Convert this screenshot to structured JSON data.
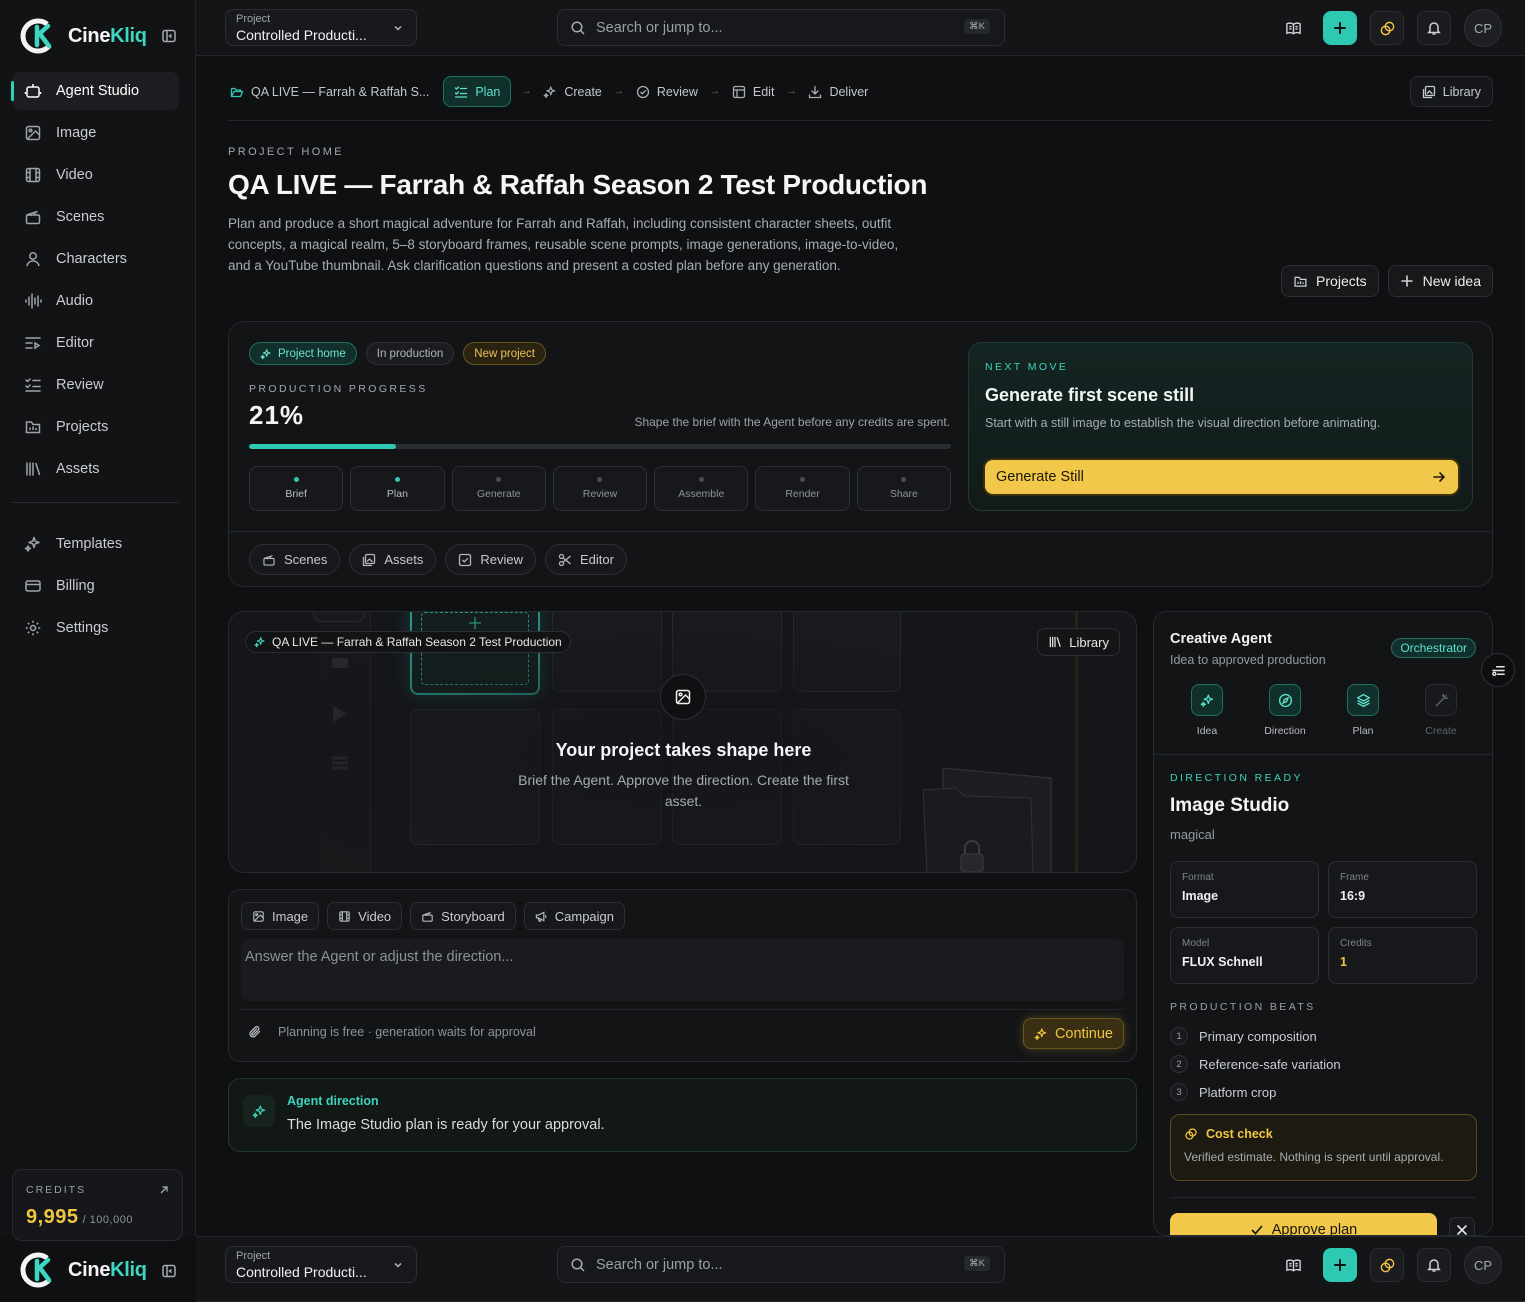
{
  "brand": {
    "name_prefix": "Cine",
    "name_accent": "Kliq",
    "accent_color": "#3ed6c1"
  },
  "sidebar": {
    "items": [
      {
        "label": "Agent Studio",
        "icon": "bot-icon",
        "active": true
      },
      {
        "label": "Image",
        "icon": "image-icon"
      },
      {
        "label": "Video",
        "icon": "film-icon"
      },
      {
        "label": "Scenes",
        "icon": "clapperboard-icon"
      },
      {
        "label": "Characters",
        "icon": "user-icon"
      },
      {
        "label": "Audio",
        "icon": "audio-wave-icon"
      },
      {
        "label": "Editor",
        "icon": "editor-icon"
      },
      {
        "label": "Review",
        "icon": "checklist-icon"
      },
      {
        "label": "Projects",
        "icon": "folder-icon"
      },
      {
        "label": "Assets",
        "icon": "library-icon"
      }
    ],
    "secondary": [
      {
        "label": "Templates",
        "icon": "sparkles-icon"
      },
      {
        "label": "Billing",
        "icon": "credit-card-icon"
      },
      {
        "label": "Settings",
        "icon": "gear-icon"
      }
    ],
    "credits": {
      "label": "CREDITS",
      "value": "9,995",
      "total": "/ 100,000"
    }
  },
  "topbar": {
    "project_label": "Project",
    "project_value": "Controlled Producti...",
    "search_placeholder": "Search or jump to...",
    "search_shortcut": "⌘K",
    "avatar_initials": "CP"
  },
  "breadcrumbs": {
    "home": "QA LIVE — Farrah & Raffah S...",
    "steps": [
      {
        "label": "Plan",
        "icon": "checklist-icon",
        "active": true
      },
      {
        "label": "Create",
        "icon": "sparkles-icon"
      },
      {
        "label": "Review",
        "icon": "check-circle-icon"
      },
      {
        "label": "Edit",
        "icon": "layout-icon"
      },
      {
        "label": "Deliver",
        "icon": "download-icon"
      }
    ],
    "library": "Library"
  },
  "header": {
    "eyebrow": "PROJECT HOME",
    "title": "QA LIVE — Farrah & Raffah Season 2 Test Production",
    "description": "Plan and produce a short magical adventure for Farrah and Raffah, including consistent character sheets, outfit concepts, a magical realm, 5–8 storyboard frames, reusable scene prompts, image generations, image-to-video, and a YouTube thumbnail. Ask clarification questions and present a costed plan before any generation.",
    "projects_button": "Projects",
    "new_idea_button": "New idea"
  },
  "production": {
    "pills": [
      "Project home",
      "In production",
      "New project"
    ],
    "eyebrow": "PRODUCTION PROGRESS",
    "progress_label": "21%",
    "progress": 0.21,
    "hint": "Shape the brief with the Agent before any credits are spent.",
    "steps": [
      {
        "label": "Brief",
        "done": true
      },
      {
        "label": "Plan",
        "done": true
      },
      {
        "label": "Generate",
        "done": false
      },
      {
        "label": "Review",
        "done": false
      },
      {
        "label": "Assemble",
        "done": false
      },
      {
        "label": "Render",
        "done": false
      },
      {
        "label": "Share",
        "done": false
      }
    ],
    "quick_links": [
      {
        "label": "Scenes",
        "icon": "clapperboard-icon"
      },
      {
        "label": "Assets",
        "icon": "images-icon"
      },
      {
        "label": "Review",
        "icon": "check-square-icon"
      },
      {
        "label": "Editor",
        "icon": "scissors-icon"
      }
    ],
    "next_move": {
      "eyebrow": "NEXT MOVE",
      "title": "Generate first scene still",
      "description": "Start with a still image to establish the visual direction before animating.",
      "button": "Generate Still"
    }
  },
  "canvas": {
    "tag": "QA LIVE — Farrah & Raffah Season 2 Test Production",
    "library": "Library",
    "headline": "Your project takes shape here",
    "sub": "Brief the Agent. Approve the direction. Create the first asset."
  },
  "composer": {
    "modes": [
      {
        "label": "Image",
        "icon": "image-icon"
      },
      {
        "label": "Video",
        "icon": "film-icon"
      },
      {
        "label": "Storyboard",
        "icon": "clapperboard-icon"
      },
      {
        "label": "Campaign",
        "icon": "megaphone-icon"
      }
    ],
    "placeholder": "Answer the Agent or adjust the direction...",
    "note": "Planning is free · generation waits for approval",
    "continue": "Continue"
  },
  "direction": {
    "title": "Agent direction",
    "text": "The Image Studio plan is ready for your approval."
  },
  "agent": {
    "title": "Creative Agent",
    "subtitle": "Idea to approved production",
    "badge": "Orchestrator",
    "stages": [
      {
        "label": "Idea",
        "icon": "sparkles-icon",
        "on": true
      },
      {
        "label": "Direction",
        "icon": "compass-icon",
        "on": true
      },
      {
        "label": "Plan",
        "icon": "layers-icon",
        "on": true
      },
      {
        "label": "Create",
        "icon": "wand-icon",
        "on": false
      }
    ],
    "ready_eyebrow": "DIRECTION READY",
    "studio": "Image Studio",
    "style": "magical",
    "specs": [
      {
        "k": "Format",
        "v": "Image"
      },
      {
        "k": "Frame",
        "v": "16:9"
      },
      {
        "k": "Model",
        "v": "FLUX Schnell"
      },
      {
        "k": "Credits",
        "v": "1"
      }
    ],
    "beats_eyebrow": "PRODUCTION BEATS",
    "beats": [
      {
        "n": "1",
        "label": "Primary composition"
      },
      {
        "n": "2",
        "label": "Reference-safe variation"
      },
      {
        "n": "3",
        "label": "Platform crop"
      }
    ],
    "cost_title": "Cost check",
    "cost_text": "Verified estimate. Nothing is spent until approval.",
    "approve": "Approve plan"
  }
}
